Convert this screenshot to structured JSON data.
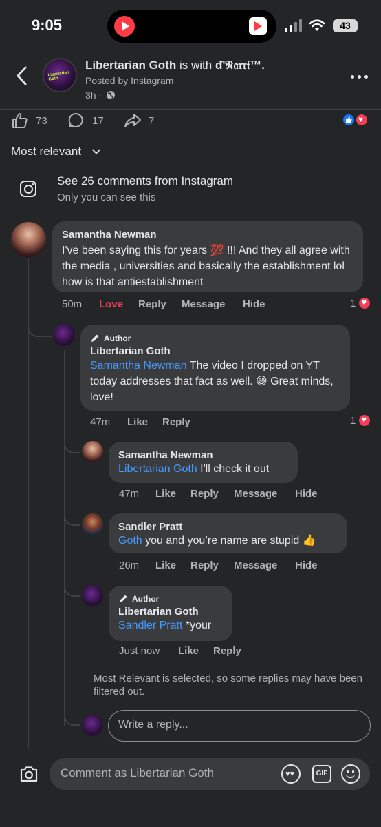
{
  "status_bar": {
    "time": "9:05",
    "battery": "43"
  },
  "header": {
    "page_name": "Libertarian Goth",
    "with_text": "is with",
    "tagged_name": "ᵭ'𝔑𝔞𝔯𝔯𝔦™.",
    "posted_by": "Posted by Instagram",
    "time": "3h ·",
    "avatar_text": "Libertarian Goth"
  },
  "stats": {
    "likes": "73",
    "comments": "17",
    "shares": "7"
  },
  "sort": {
    "label": "Most relevant"
  },
  "instagram": {
    "title": "See 26 comments from Instagram",
    "subtitle": "Only you can see this"
  },
  "comments": {
    "c1": {
      "name": "Samantha Newman",
      "text": "I've been saying this for years 💯 !!! And they all agree with the media , universities and basically the establishment lol how is that antiestablishment",
      "time": "50m",
      "love": "Love",
      "reply": "Reply",
      "message": "Message",
      "hide": "Hide",
      "reactions": "1"
    },
    "r1": {
      "badge": "Author",
      "name": "Libertarian Goth",
      "mention": "Samantha Newman",
      "text": " The video I dropped on YT today addresses that fact as well. 😄 Great minds, love!",
      "time": "47m",
      "like": "Like",
      "reply": "Reply",
      "reactions": "1"
    },
    "r2": {
      "name": "Samantha Newman",
      "mention": "Libertarian Goth",
      "text": " I'll check it out",
      "time": "47m",
      "like": "Like",
      "reply": "Reply",
      "message": "Message",
      "hide": "Hide"
    },
    "r3": {
      "name": "Sandler Pratt",
      "mention": "Goth",
      "text": " you and you’re name are stupid 👍",
      "time": "26m",
      "like": "Like",
      "reply": "Reply",
      "message": "Message",
      "hide": "Hide"
    },
    "r4": {
      "badge": "Author",
      "name": "Libertarian Goth",
      "mention": "Sandler Pratt",
      "text": " *your",
      "time": "Just now",
      "like": "Like",
      "reply": "Reply"
    }
  },
  "filter_note": "Most Relevant is selected, so some replies may have been filtered out.",
  "reply_input": {
    "placeholder": "Write a reply..."
  },
  "comment_input": {
    "placeholder": "Comment as Libertarian Goth"
  },
  "colors": {
    "background": "#242526",
    "bubble": "#3a3b3c",
    "mention": "#4599ff",
    "love": "#f33e58",
    "like": "#1877f2"
  }
}
